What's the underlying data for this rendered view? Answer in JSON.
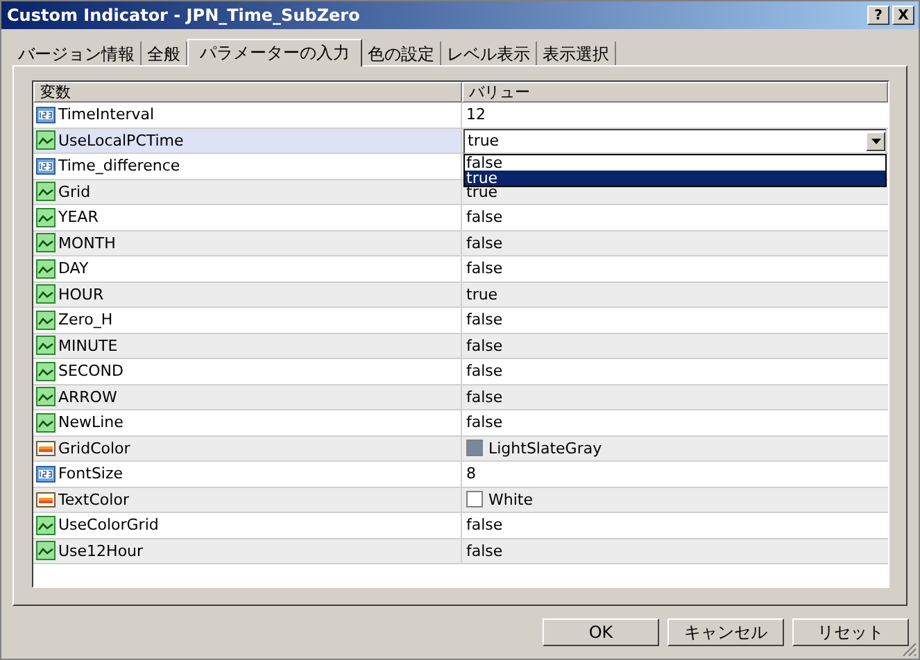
{
  "window": {
    "title": "Custom Indicator - JPN_Time_SubZero",
    "title_buttons": [
      "?",
      "X"
    ]
  },
  "tabs": [
    {
      "label": "バージョン情報",
      "selected": false
    },
    {
      "label": "全般",
      "selected": false
    },
    {
      "label": "パラメーターの入力",
      "selected": true
    },
    {
      "label": "色の設定",
      "selected": false
    },
    {
      "label": "レベル表示",
      "selected": false
    },
    {
      "label": "表示選択",
      "selected": false
    }
  ],
  "table": {
    "columns": [
      "変数",
      "バリュー"
    ],
    "rows": [
      {
        "kind": "number",
        "name": "TimeInterval",
        "value": "12",
        "selected": false
      },
      {
        "kind": "bool",
        "name": "UseLocalPCTime",
        "value": "true",
        "selected": true,
        "dropdown": {
          "options": [
            {
              "label": "false",
              "selected": false
            },
            {
              "label": "true",
              "selected": true
            }
          ]
        }
      },
      {
        "kind": "number",
        "name": "Time_difference",
        "selected": false
      },
      {
        "kind": "bool",
        "name": "Grid",
        "value": "true",
        "selected": false
      },
      {
        "kind": "bool",
        "name": "YEAR",
        "value": "false",
        "selected": false
      },
      {
        "kind": "bool",
        "name": "MONTH",
        "value": "false",
        "selected": false
      },
      {
        "kind": "bool",
        "name": "DAY",
        "value": "false",
        "selected": false
      },
      {
        "kind": "bool",
        "name": "HOUR",
        "value": "true",
        "selected": false
      },
      {
        "kind": "bool",
        "name": "Zero_H",
        "value": "false",
        "selected": false
      },
      {
        "kind": "bool",
        "name": "MINUTE",
        "value": "false",
        "selected": false
      },
      {
        "kind": "bool",
        "name": "SECOND",
        "value": "false",
        "selected": false
      },
      {
        "kind": "bool",
        "name": "ARROW",
        "value": "false",
        "selected": false
      },
      {
        "kind": "bool",
        "name": "NewLine",
        "value": "false",
        "selected": false
      },
      {
        "kind": "color",
        "name": "GridColor",
        "value": "LightSlateGray",
        "color": "#778899",
        "selected": false
      },
      {
        "kind": "number",
        "name": "FontSize",
        "value": "8",
        "selected": false
      },
      {
        "kind": "color",
        "name": "TextColor",
        "value": "White",
        "color": "#ffffff",
        "selected": false
      },
      {
        "kind": "bool",
        "name": "UseColorGrid",
        "value": "false",
        "selected": false
      },
      {
        "kind": "bool",
        "name": "Use12Hour",
        "value": "false",
        "selected": false
      }
    ]
  },
  "buttons": [
    "OK",
    "キャンセル",
    "リセット"
  ]
}
